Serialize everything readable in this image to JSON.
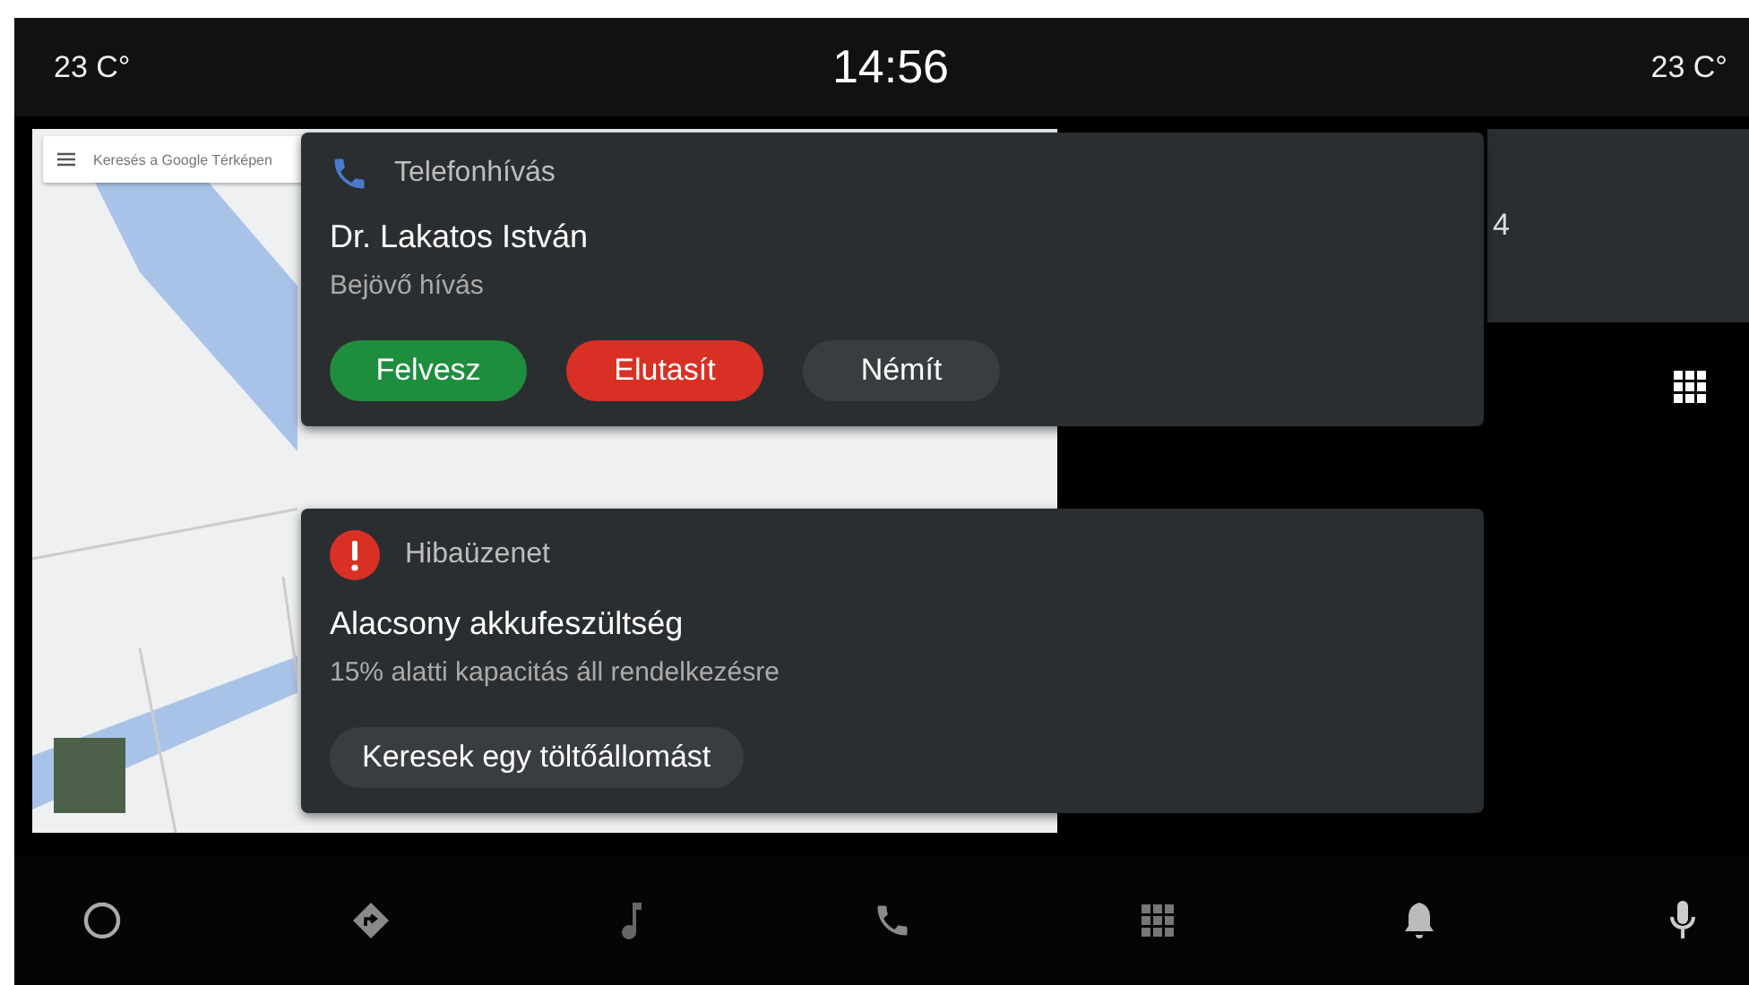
{
  "status_bar": {
    "temp_left": "23 C°",
    "clock": "14:56",
    "temp_right": "23 C°"
  },
  "map": {
    "search": {
      "placeholder": "Keresés a Google Térképen"
    }
  },
  "side_card": {
    "text": "4"
  },
  "notifications": [
    {
      "kind": "call",
      "app": "Telefonhívás",
      "title": "Dr. Lakatos István",
      "subtitle": "Bejövő hívás",
      "actions": [
        {
          "label": "Felvesz",
          "kind": "accept"
        },
        {
          "label": "Elutasít",
          "kind": "decline"
        },
        {
          "label": "Némít",
          "kind": "neutral"
        }
      ]
    },
    {
      "kind": "error",
      "app": "Hibaüzenet",
      "title": "Alacsony akkufeszültség",
      "subtitle": "15% alatti kapacitás áll rendelkezésre",
      "actions": [
        {
          "label": "Keresek egy töltőállomást",
          "kind": "neutral"
        }
      ]
    }
  ],
  "nav": [
    {
      "kind": "home"
    },
    {
      "kind": "navigation"
    },
    {
      "kind": "music"
    },
    {
      "kind": "phone"
    },
    {
      "kind": "apps"
    },
    {
      "kind": "notifications"
    },
    {
      "kind": "voice"
    }
  ]
}
